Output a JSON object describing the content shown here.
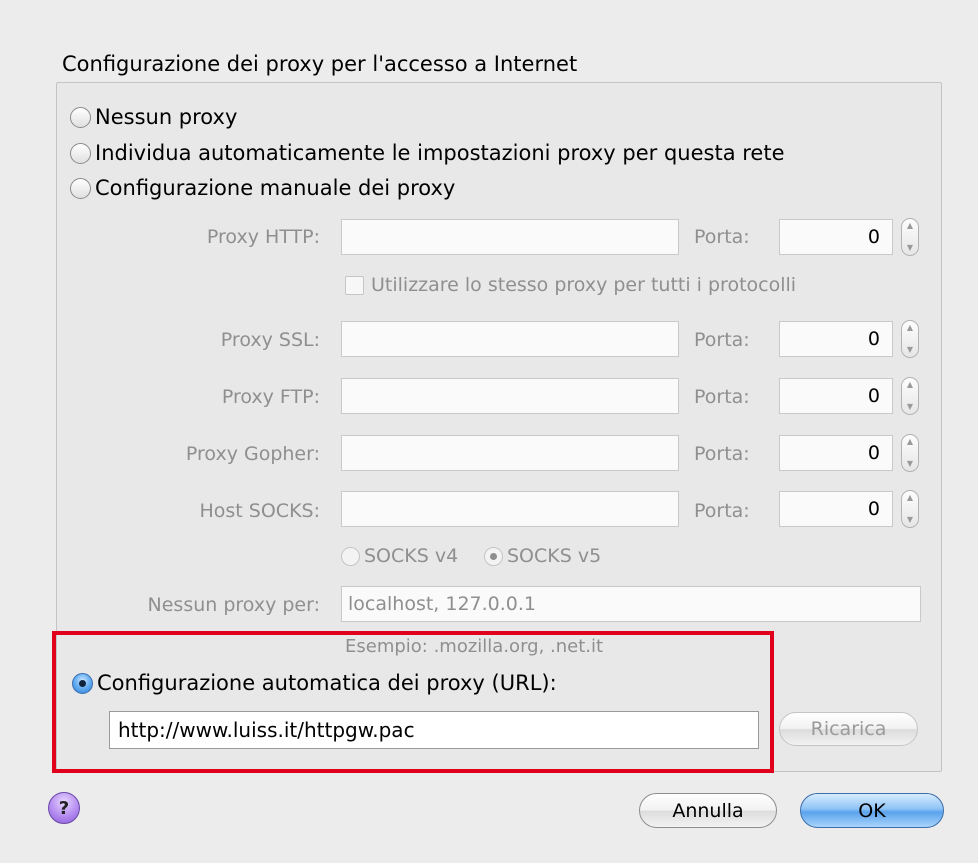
{
  "dialog": {
    "group_title": "Configurazione dei proxy per l'accesso a Internet",
    "options": {
      "no_proxy": "Nessun proxy",
      "auto_detect": "Individua automaticamente le impostazioni proxy per questa rete",
      "manual": "Configurazione manuale dei proxy",
      "auto_url": "Configurazione automatica dei proxy (URL):"
    },
    "selected_option": "auto_url",
    "manual": {
      "http_label": "Proxy HTTP:",
      "ssl_label": "Proxy SSL:",
      "ftp_label": "Proxy FTP:",
      "gopher_label": "Proxy Gopher:",
      "socks_label": "Host SOCKS:",
      "port_label": "Porta:",
      "http_port": "0",
      "ssl_port": "0",
      "ftp_port": "0",
      "gopher_port": "0",
      "socks_port": "0",
      "same_proxy_label": "Utilizzare lo stesso proxy per tutti i protocolli",
      "socks_v4": "SOCKS v4",
      "socks_v5": "SOCKS v5",
      "socks_selected": "v5",
      "no_proxy_for_label": "Nessun proxy per:",
      "no_proxy_for_value": "localhost, 127.0.0.1",
      "example": "Esempio: .mozilla.org, .net.it"
    },
    "auto_url_value": "http://www.luiss.it/httpgw.pac",
    "reload_label": "Ricarica",
    "help_symbol": "?",
    "cancel_label": "Annulla",
    "ok_label": "OK"
  },
  "colors": {
    "highlight_box": "#e0001b",
    "default_button": "#5aa3ec",
    "disabled_text": "#8f8f8f"
  }
}
